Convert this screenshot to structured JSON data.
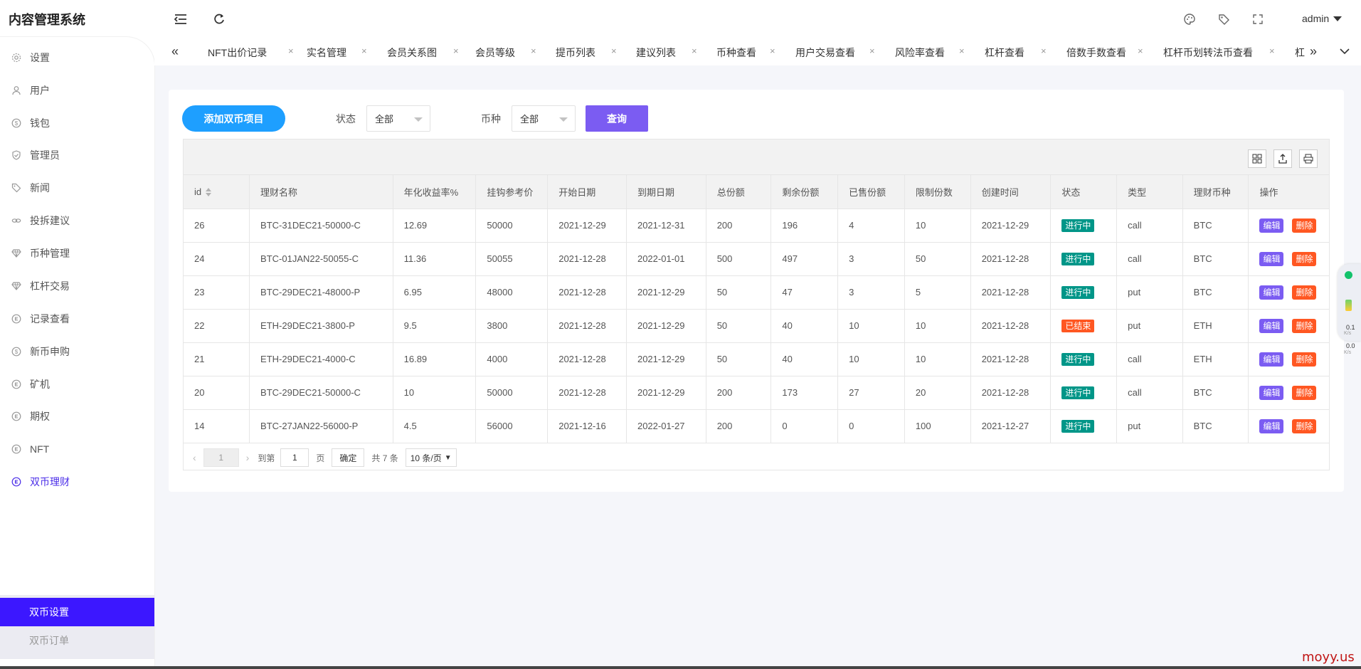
{
  "app": {
    "title": "内容管理系统"
  },
  "sidebar": {
    "items": [
      {
        "label": "设置",
        "icon": "gear-icon"
      },
      {
        "label": "用户",
        "icon": "user-icon"
      },
      {
        "label": "钱包",
        "icon": "coin-icon"
      },
      {
        "label": "管理员",
        "icon": "shield-icon"
      },
      {
        "label": "新闻",
        "icon": "tag-icon"
      },
      {
        "label": "投拆建议",
        "icon": "link-icon"
      },
      {
        "label": "币种管理",
        "icon": "diamond-icon"
      },
      {
        "label": "杠杆交易",
        "icon": "diamond-icon"
      },
      {
        "label": "记录查看",
        "icon": "circle-e-icon"
      },
      {
        "label": "新币申购",
        "icon": "coin-icon"
      },
      {
        "label": "矿机",
        "icon": "circle-e-icon"
      },
      {
        "label": "期权",
        "icon": "circle-e-icon"
      },
      {
        "label": "NFT",
        "icon": "circle-e-icon"
      },
      {
        "label": "双币理财",
        "icon": "circle-e-icon",
        "active": true
      }
    ],
    "submenu": [
      {
        "label": "双币设置",
        "selected": true
      },
      {
        "label": "双币订单"
      }
    ]
  },
  "header": {
    "user": "admin",
    "icons": [
      "menu-collapse-icon",
      "refresh-icon",
      "palette-icon",
      "tag-icon",
      "fullscreen-icon"
    ]
  },
  "tabs": [
    "NFT出价记录",
    "实名管理",
    "会员关系图",
    "会员等级",
    "提币列表",
    "建议列表",
    "币种查看",
    "用户交易查看",
    "风险率查看",
    "杠杆查看",
    "倍数手数查看",
    "杠杆币划转法币查看",
    "杠"
  ],
  "filters": {
    "add_button": "添加双币项目",
    "status_label": "状态",
    "status_value": "全部",
    "coin_label": "币种",
    "coin_value": "全部",
    "query_button": "查询"
  },
  "table": {
    "columns": [
      "id",
      "理财名称",
      "年化收益率%",
      "挂钩参考价",
      "开始日期",
      "到期日期",
      "总份额",
      "剩余份额",
      "已售份额",
      "限制份数",
      "创建时间",
      "状态",
      "类型",
      "理财币种",
      "操作"
    ],
    "rows": [
      [
        "26",
        "BTC-31DEC21-50000-C",
        "12.69",
        "50000",
        "2021-12-29",
        "2021-12-31",
        "200",
        "196",
        "4",
        "10",
        "2021-12-29",
        "进行中",
        "call",
        "BTC"
      ],
      [
        "24",
        "BTC-01JAN22-50055-C",
        "11.36",
        "50055",
        "2021-12-28",
        "2022-01-01",
        "500",
        "497",
        "3",
        "50",
        "2021-12-28",
        "进行中",
        "call",
        "BTC"
      ],
      [
        "23",
        "BTC-29DEC21-48000-P",
        "6.95",
        "48000",
        "2021-12-28",
        "2021-12-29",
        "50",
        "47",
        "3",
        "5",
        "2021-12-28",
        "进行中",
        "put",
        "BTC"
      ],
      [
        "22",
        "ETH-29DEC21-3800-P",
        "9.5",
        "3800",
        "2021-12-28",
        "2021-12-29",
        "50",
        "40",
        "10",
        "10",
        "2021-12-28",
        "已结束",
        "put",
        "ETH"
      ],
      [
        "21",
        "ETH-29DEC21-4000-C",
        "16.89",
        "4000",
        "2021-12-28",
        "2021-12-29",
        "50",
        "40",
        "10",
        "10",
        "2021-12-28",
        "进行中",
        "call",
        "ETH"
      ],
      [
        "20",
        "BTC-29DEC21-50000-C",
        "10",
        "50000",
        "2021-12-28",
        "2021-12-29",
        "200",
        "173",
        "27",
        "20",
        "2021-12-28",
        "进行中",
        "call",
        "BTC"
      ],
      [
        "14",
        "BTC-27JAN22-56000-P",
        "4.5",
        "56000",
        "2021-12-16",
        "2022-01-27",
        "200",
        "0",
        "0",
        "100",
        "2021-12-27",
        "进行中",
        "put",
        "BTC"
      ]
    ],
    "actions": {
      "edit": "编辑",
      "delete": "删除"
    },
    "status_colors": {
      "进行中": "#009688",
      "已结束": "#ff5722"
    }
  },
  "pagination": {
    "current": "1",
    "goto_label": "到第",
    "goto_value": "1",
    "page_label": "页",
    "confirm": "确定",
    "total": "共 7 条",
    "page_size": "10 条/页"
  },
  "widget": {
    "up": "0.1",
    "up_unit": "K/s",
    "down": "0.0",
    "down_unit": "K/s"
  },
  "watermark": "moyy.us",
  "colors": {
    "accent": "#3c17ff",
    "add_button": "#1e9fff",
    "query_button": "#7b5cf2"
  }
}
